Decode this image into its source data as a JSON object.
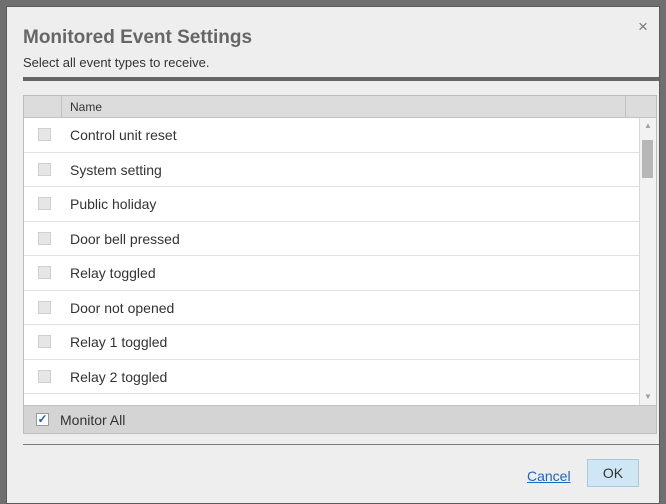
{
  "dialog": {
    "title": "Monitored Event Settings",
    "subtitle": "Select all event types to receive.",
    "close_label": "×"
  },
  "table": {
    "column_name": "Name",
    "rows": [
      {
        "label": "Control unit reset",
        "checked": false
      },
      {
        "label": "System setting",
        "checked": false
      },
      {
        "label": "Public holiday",
        "checked": false
      },
      {
        "label": "Door bell pressed",
        "checked": false
      },
      {
        "label": "Relay toggled",
        "checked": false
      },
      {
        "label": "Door not opened",
        "checked": false
      },
      {
        "label": "Relay 1 toggled",
        "checked": false
      },
      {
        "label": "Relay 2 toggled",
        "checked": false
      }
    ],
    "monitor_all": {
      "label": "Monitor All",
      "checked": true,
      "check_glyph": "✓"
    }
  },
  "buttons": {
    "cancel": "Cancel",
    "ok": "OK"
  },
  "icons": {
    "close": "close-icon",
    "scroll_up": "scroll-up-icon",
    "scroll_down": "scroll-down-icon",
    "check": "checkmark-icon"
  },
  "colors": {
    "accent": "#1a66c6",
    "ok_button_bg": "#cfe7f4"
  }
}
